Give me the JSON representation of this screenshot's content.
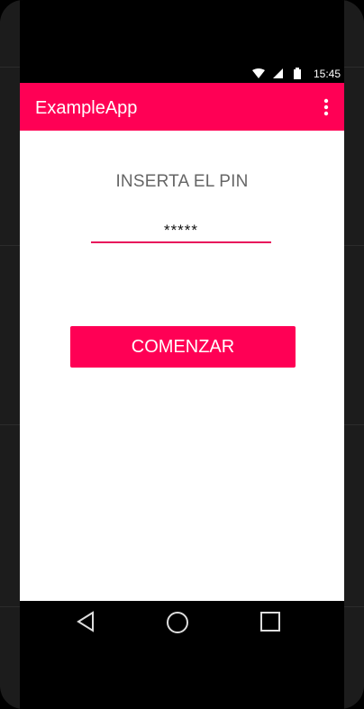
{
  "status_bar": {
    "time": "15:45"
  },
  "toolbar": {
    "title": "ExampleApp"
  },
  "main": {
    "prompt": "INSERTA EL PIN",
    "pin_value": "*****",
    "start_button": "COMENZAR"
  },
  "icons": {
    "wifi": "wifi-icon",
    "signal": "signal-icon",
    "battery": "battery-icon",
    "overflow": "overflow-menu-icon",
    "back": "back-icon",
    "home": "home-icon",
    "recents": "recents-icon"
  },
  "colors": {
    "accent": "#ff0055",
    "underline": "#e8115b",
    "prompt_text": "#666666",
    "background": "#ffffff"
  }
}
